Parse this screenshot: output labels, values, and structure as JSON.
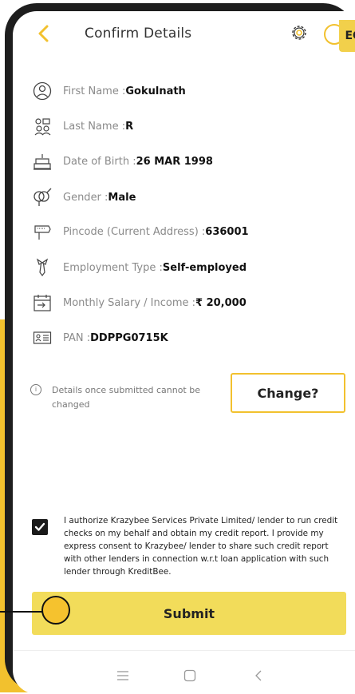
{
  "header": {
    "title": "Confirm Details",
    "badge": "EG"
  },
  "details": [
    {
      "icon": "user-circle-icon",
      "label": "First Name : ",
      "value": "Gokulnath"
    },
    {
      "icon": "family-icon",
      "label": "Last Name : ",
      "value": "R"
    },
    {
      "icon": "cake-icon",
      "label": "Date of Birth : ",
      "value": "26 MAR 1998"
    },
    {
      "icon": "gender-icon",
      "label": "Gender : ",
      "value": "Male"
    },
    {
      "icon": "mailbox-icon",
      "label": "Pincode (Current Address) : ",
      "value": "636001"
    },
    {
      "icon": "tie-icon",
      "label": "Employment Type : ",
      "value": "Self-employed"
    },
    {
      "icon": "calendar-icon",
      "label": "Monthly Salary / Income : ",
      "value": "₹ 20,000"
    },
    {
      "icon": "id-card-icon",
      "label": "PAN : ",
      "value": "DDPPG0715K"
    }
  ],
  "note": {
    "text": "Details once submitted cannot be changed"
  },
  "change_button": "Change?",
  "consent": {
    "checked": true,
    "text": "I authorize Krazybee Services Private Limited/ lender to run credit checks on my behalf and obtain my credit report. I provide my express consent to Krazybee/ lender to share such credit report with other lenders in connection w.r.t loan application with such lender through KreditBee."
  },
  "submit_button": "Submit",
  "colors": {
    "accent": "#f2c12e",
    "submit_bg": "#f2dc5a",
    "badge_bg": "#f2d04b",
    "frame": "#1e1e1e"
  }
}
